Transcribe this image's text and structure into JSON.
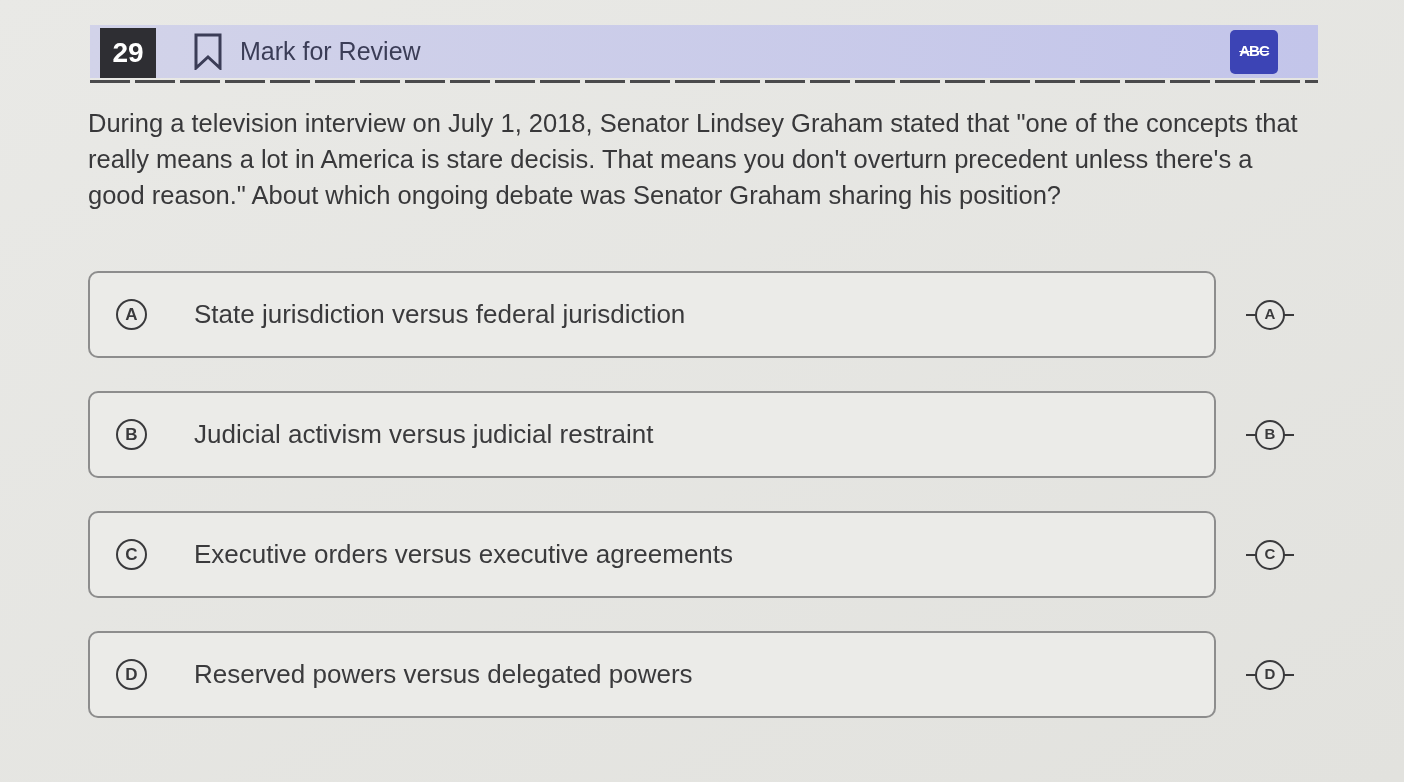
{
  "header": {
    "question_number": "29",
    "mark_for_review": {
      "label": "Mark for Review",
      "marked": false
    },
    "eliminator_tool": {
      "label": "ABC",
      "on": true
    }
  },
  "question": {
    "text": "During a television interview on July 1, 2018, Senator Lindsey Graham stated that \"one of the concepts that really means a lot in America is stare decisis. That means you don't overturn precedent unless there's a good reason.\" About which ongoing debate was Senator Graham sharing his position?"
  },
  "choices": [
    {
      "letter": "A",
      "text": "State jurisdiction versus federal jurisdiction",
      "strike_letter": "A",
      "selected": false
    },
    {
      "letter": "B",
      "text": "Judicial activism versus judicial restraint",
      "strike_letter": "B",
      "selected": false
    },
    {
      "letter": "C",
      "text": "Executive orders versus executive agreements",
      "strike_letter": "C",
      "selected": false
    },
    {
      "letter": "D",
      "text": "Reserved powers versus delegated powers",
      "strike_letter": "D",
      "selected": false
    }
  ]
}
